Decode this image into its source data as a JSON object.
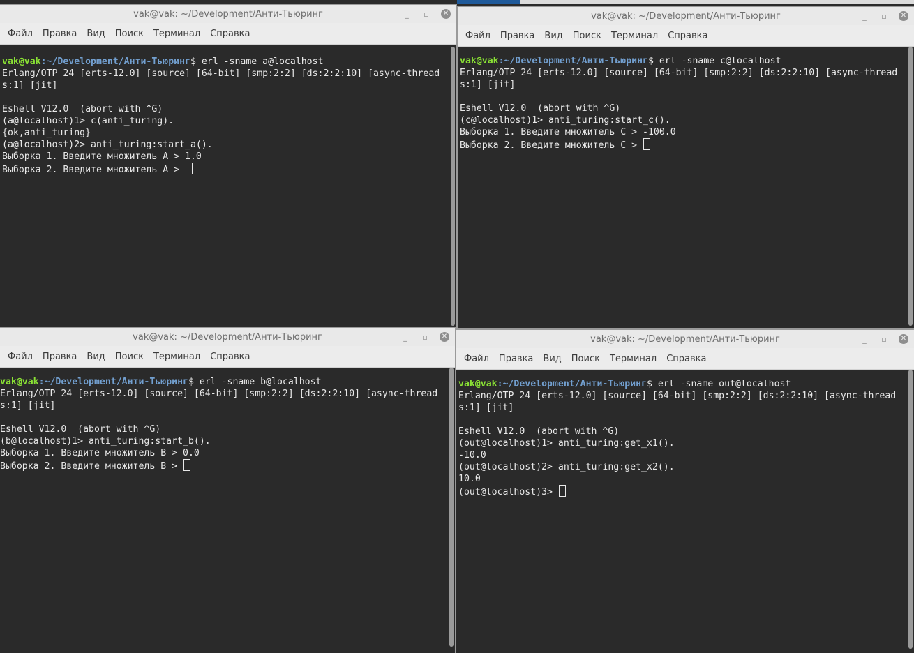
{
  "menu": [
    "Файл",
    "Правка",
    "Вид",
    "Поиск",
    "Терминал",
    "Справка"
  ],
  "windows": {
    "a": {
      "title": "vak@vak: ~/Development/Анти-Тьюринг",
      "user": "vak@vak",
      "cwd": ":~/Development/Анти-Тьюринг",
      "command": "$ erl -sname a@localhost",
      "lines": [
        "Erlang/OTP 24 [erts-12.0] [source] [64-bit] [smp:2:2] [ds:2:2:10] [async-threads:1] [jit]",
        "",
        "Eshell V12.0  (abort with ^G)",
        "(a@localhost)1> c(anti_turing).",
        "{ok,anti_turing}",
        "(a@localhost)2> anti_turing:start_a().",
        "Выборка 1. Введите множитель A > 1.0"
      ],
      "last_line": "Выборка 2. Введите множитель A > "
    },
    "c": {
      "title": "vak@vak: ~/Development/Анти-Тьюринг",
      "user": "vak@vak",
      "cwd": ":~/Development/Анти-Тьюринг",
      "command": "$ erl -sname c@localhost",
      "lines": [
        "Erlang/OTP 24 [erts-12.0] [source] [64-bit] [smp:2:2] [ds:2:2:10] [async-threads:1] [jit]",
        "",
        "Eshell V12.0  (abort with ^G)",
        "(c@localhost)1> anti_turing:start_c().",
        "Выборка 1. Введите множитель C > -100.0"
      ],
      "last_line": "Выборка 2. Введите множитель C > "
    },
    "b": {
      "title": "vak@vak: ~/Development/Анти-Тьюринг",
      "user": "vak@vak",
      "cwd": ":~/Development/Анти-Тьюринг",
      "command": "$ erl -sname b@localhost",
      "lines": [
        "Erlang/OTP 24 [erts-12.0] [source] [64-bit] [smp:2:2] [ds:2:2:10] [async-threads:1] [jit]",
        "",
        "Eshell V12.0  (abort with ^G)",
        "(b@localhost)1> anti_turing:start_b().",
        "Выборка 1. Введите множитель B > 0.0"
      ],
      "last_line": "Выборка 2. Введите множитель B > "
    },
    "out": {
      "title": "vak@vak: ~/Development/Анти-Тьюринг",
      "user": "vak@vak",
      "cwd": ":~/Development/Анти-Тьюринг",
      "command": "$ erl -sname out@localhost",
      "lines": [
        "Erlang/OTP 24 [erts-12.0] [source] [64-bit] [smp:2:2] [ds:2:2:10] [async-threads:1] [jit]",
        "",
        "Eshell V12.0  (abort with ^G)",
        "(out@localhost)1> anti_turing:get_x1().",
        "-10.0",
        "(out@localhost)2> anti_turing:get_x2().",
        "10.0"
      ],
      "last_line": "(out@localhost)3> "
    }
  },
  "colors": {
    "user_prompt": "#8ae234",
    "path_prompt": "#729fcf",
    "terminal_bg": "#2a2a2a",
    "terminal_fg": "#e8e8e8",
    "titlebar_bg": "#e9e9e9"
  }
}
